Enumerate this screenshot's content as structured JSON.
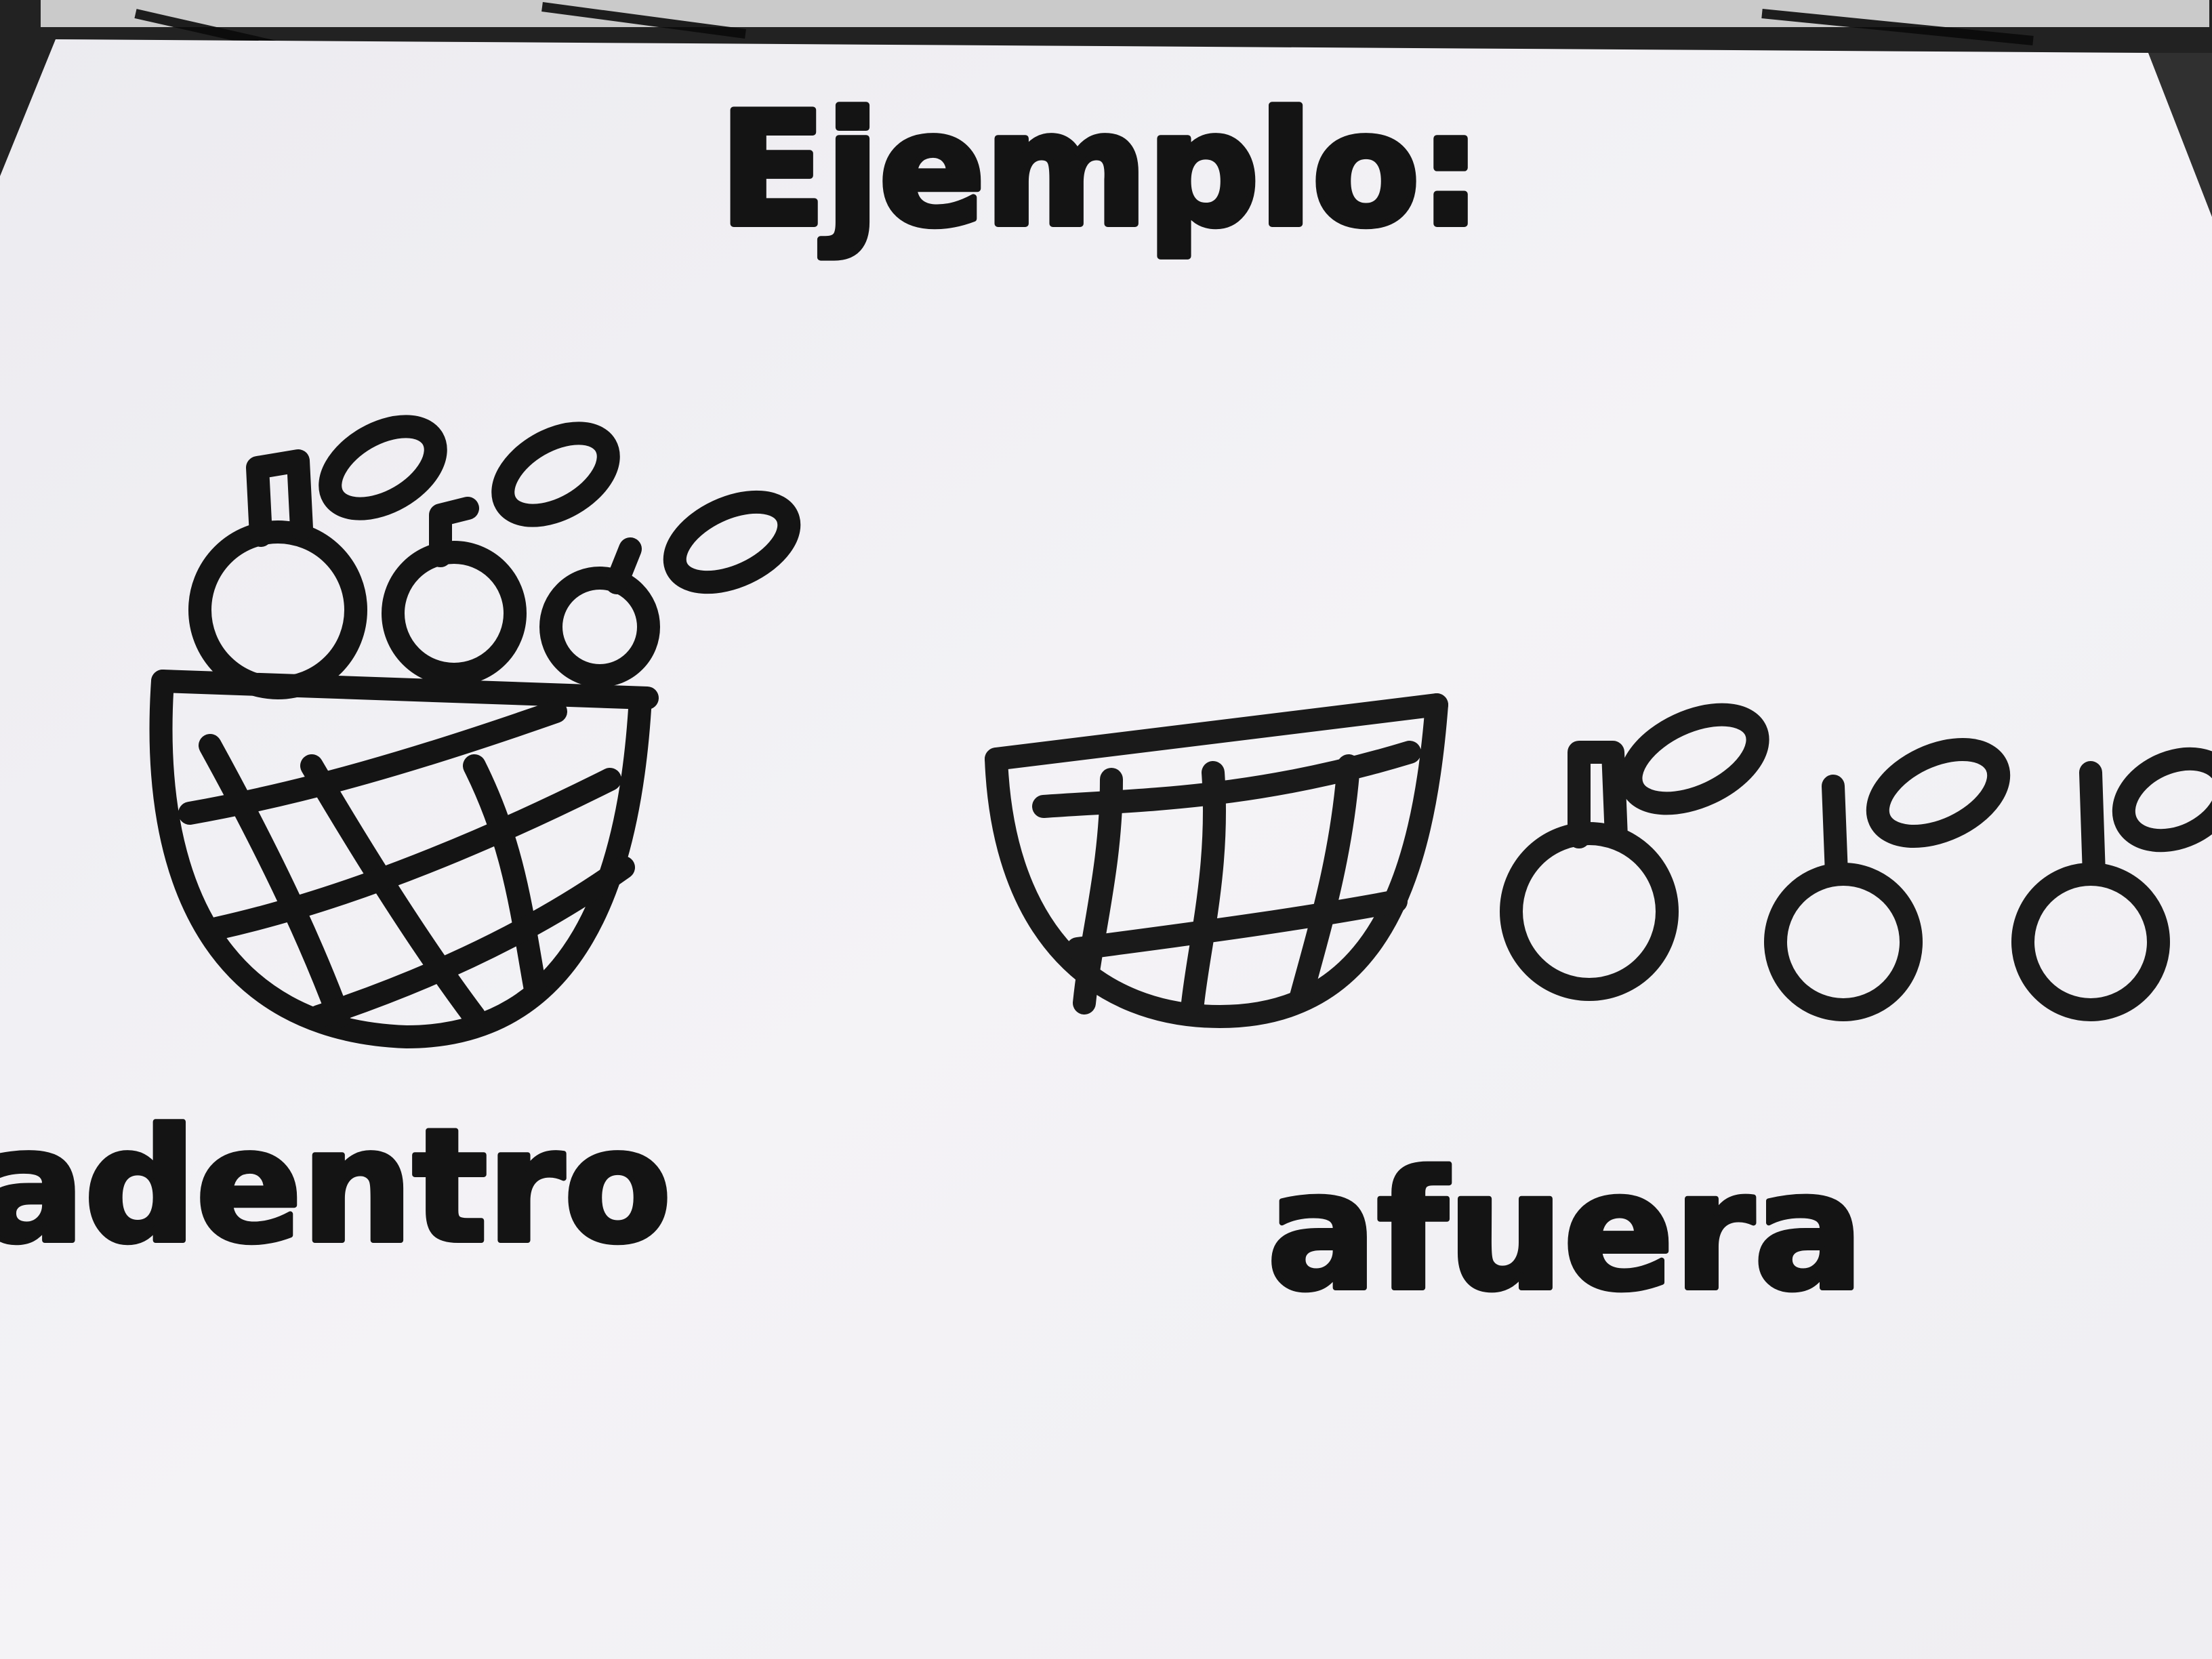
{
  "sheet": {
    "title": "Ejemplo:",
    "labels": {
      "inside": "adentro",
      "outside": "afuera"
    }
  },
  "colors": {
    "paper": "#f3f1f5",
    "ink": "#141414",
    "background_fabric": "#2a2a2a"
  },
  "drawings": {
    "left": "basket-with-fruit-inside",
    "right": "empty-basket-with-three-fruits-outside"
  }
}
